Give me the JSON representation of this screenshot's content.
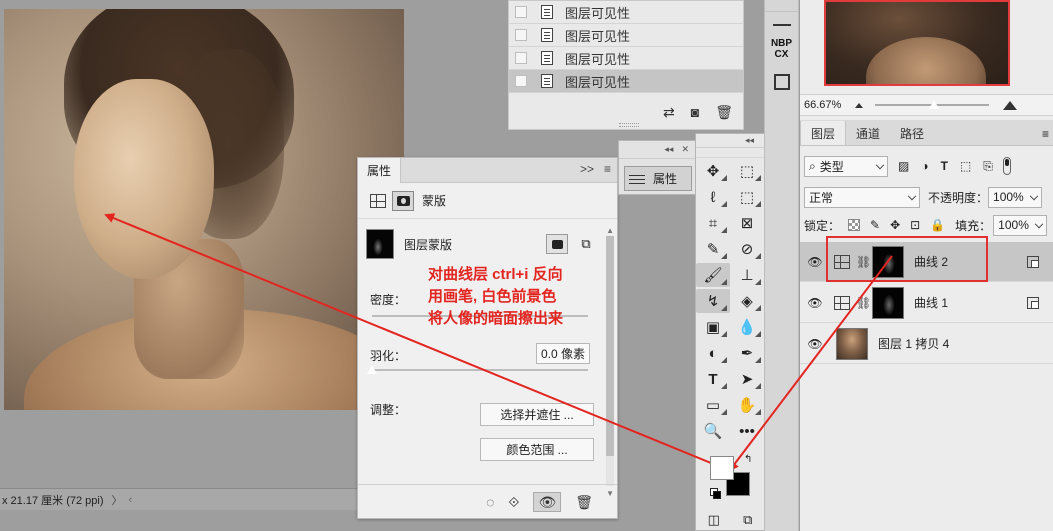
{
  "canvas": {
    "statusbar_text": "x 21.17 厘米 (72 ppi)",
    "statusbar_more": "〉",
    "statusbar_scroll": "‹"
  },
  "layer_comps": {
    "rows": [
      {
        "label": "图层可见性"
      },
      {
        "label": "图层可见性"
      },
      {
        "label": "图层可见性"
      },
      {
        "label": "图层可见性"
      }
    ]
  },
  "properties": {
    "tab_label": "属性",
    "collapse_label": ">>",
    "header_label": "蒙版",
    "mask_label": "图层蒙版",
    "density_label": "密度：",
    "feather_label": "羽化：",
    "feather_value": "0.0 像素",
    "adjust_label": "调整：",
    "select_mask_button": "选择并遮住 ...",
    "color_range_button": "颜色范围 ..."
  },
  "mini_panel": {
    "properties_button": "属性"
  },
  "icon_strip": {
    "nbp_text": "NBP CX"
  },
  "navigator": {
    "zoom": "66.67%"
  },
  "layers": {
    "tabs": [
      "图层",
      "通道",
      "路径"
    ],
    "filter_kind": "类型",
    "blend_mode": "正常",
    "opacity_label": "不透明度：",
    "opacity_value": "100%",
    "lock_label": "锁定：",
    "fill_label": "填充：",
    "fill_value": "100%",
    "items": [
      {
        "name": "曲线 2",
        "type": "curves"
      },
      {
        "name": "曲线 1",
        "type": "curves"
      },
      {
        "name": "图层 1 拷贝 4",
        "type": "pixel"
      }
    ]
  },
  "annotation": {
    "lines": [
      "对曲线层 ctrl+i 反向",
      "用画笔, 白色前景色",
      "将人像的暗面擦出来"
    ],
    "color": "#e3241f"
  },
  "colors": {
    "foreground": "#ffffff",
    "background": "#000000",
    "highlight": "#e0312f"
  }
}
